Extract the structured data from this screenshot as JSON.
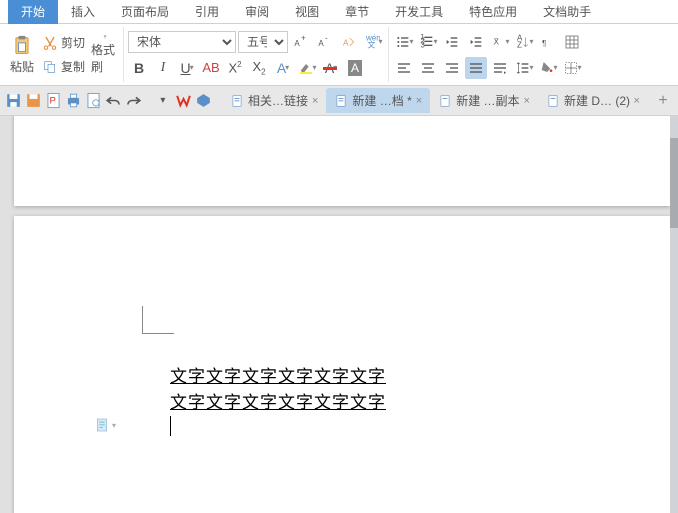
{
  "menu": {
    "start": "开始",
    "insert": "插入",
    "layout": "页面布局",
    "ref": "引用",
    "review": "审阅",
    "view": "视图",
    "chapter": "章节",
    "dev": "开发工具",
    "special": "特色应用",
    "helper": "文档助手"
  },
  "ribbon": {
    "paste": "粘贴",
    "cut": "剪切",
    "copy": "复制",
    "painter": "格式刷",
    "font_name": "宋体",
    "font_size": "五号"
  },
  "tabs": [
    {
      "label": "相关…链接"
    },
    {
      "label": "新建 …档 *"
    },
    {
      "label": "新建 …副本"
    },
    {
      "label": "新建 D… (2)"
    }
  ],
  "doc": {
    "line1": "文字文字文字文字文字文字",
    "line2": "文字文字文字文字文字文字"
  }
}
